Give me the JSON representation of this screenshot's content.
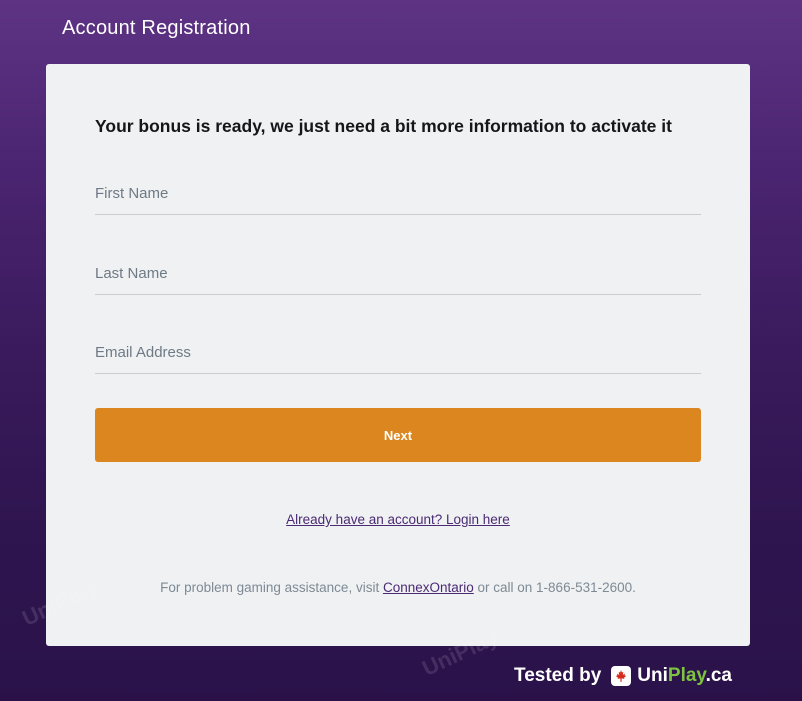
{
  "header": {
    "title": "Account Registration"
  },
  "form": {
    "heading": "Your bonus is ready, we just need a bit more information to activate it",
    "fields": [
      {
        "placeholder": "First Name",
        "value": ""
      },
      {
        "placeholder": "Last Name",
        "value": ""
      },
      {
        "placeholder": "Email Address",
        "value": ""
      }
    ],
    "next_label": "Next",
    "login_link": "Already have an account? Login here",
    "help": {
      "prefix": "For problem gaming assistance, visit ",
      "link": "ConnexOntario",
      "suffix": " or call on 1-866-531-2600."
    }
  },
  "badge": {
    "tested_by": "Tested by",
    "brand_uni": "Uni",
    "brand_play": "Play",
    "brand_tld": ".ca",
    "icon": "maple-leaf-icon"
  },
  "watermark": {
    "text": "UniPlay"
  },
  "colors": {
    "accent": "#db861f",
    "brand_green": "#7ec241",
    "link": "#4b2a73"
  }
}
